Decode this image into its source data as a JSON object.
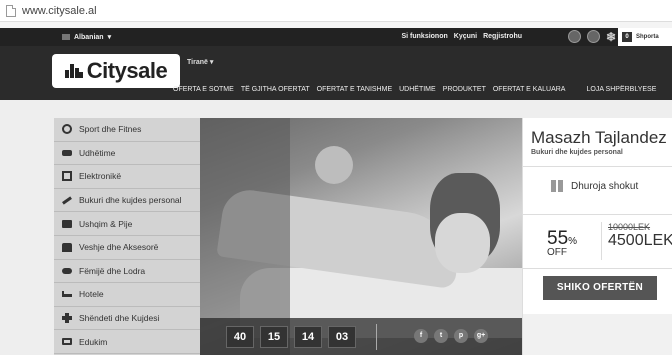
{
  "browser": {
    "url": "www.citysale.al"
  },
  "topbar": {
    "language": "Albanian",
    "links": [
      "Si funksionon",
      "Kyçuni",
      "Regjistrohu"
    ],
    "cart_count": "0",
    "cart_label": "Shporta"
  },
  "header": {
    "logo_text": "Citysale",
    "city": "Tiranë",
    "nav": [
      "OFERTA E SOTME",
      "TË GJITHA OFERTAT",
      "OFERTAT E TANISHME",
      "UDHËTIME",
      "PRODUKTET",
      "OFERTAT E KALUARA",
      "LOJA SHPËRBLYESE"
    ]
  },
  "sidebar": {
    "items": [
      {
        "label": "Sport dhe Fitnes",
        "icon": "ball-icon"
      },
      {
        "label": "Udhëtime",
        "icon": "plane-icon"
      },
      {
        "label": "Elektronikë",
        "icon": "chip-icon"
      },
      {
        "label": "Bukuri dhe kujdes personal",
        "icon": "brush-icon"
      },
      {
        "label": "Ushqim & Pije",
        "icon": "plate-icon"
      },
      {
        "label": "Veshje dhe Aksesorë",
        "icon": "shirt-icon"
      },
      {
        "label": "Fëmijë dhe Lodra",
        "icon": "toy-car-icon"
      },
      {
        "label": "Hotele",
        "icon": "bed-icon"
      },
      {
        "label": "Shëndeti dhe Kujdesi",
        "icon": "plus-icon"
      },
      {
        "label": "Edukim",
        "icon": "book-icon"
      }
    ]
  },
  "countdown": [
    "40",
    "15",
    "14",
    "03"
  ],
  "social": [
    "f",
    "t",
    "p",
    "g+"
  ],
  "offer": {
    "title": "Masazh Tajlandez",
    "subtitle": "Bukuri dhe kujdes personal",
    "gift_label": "Dhuroja shokut",
    "discount_value": "55",
    "discount_unit": "%",
    "discount_off": "OFF",
    "old_price": "10000LEK",
    "new_price": "4500LEK",
    "cta": "SHIKO OFERTËN"
  }
}
